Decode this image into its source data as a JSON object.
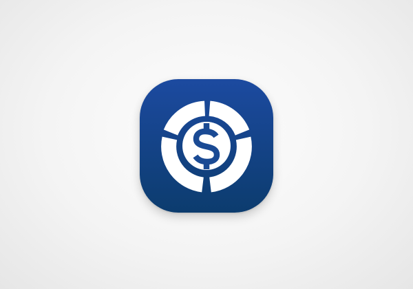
{
  "app_icon": {
    "name": "dollar-ring-app-icon",
    "glyph_icon": "dollar-sign-icon",
    "ring_icon": "segmented-ring-icon",
    "colors": {
      "gradient_top": "#1c4aa0",
      "gradient_bottom": "#0c3c6e",
      "symbol": "#ffffff",
      "background": "#f2f2f2"
    }
  }
}
